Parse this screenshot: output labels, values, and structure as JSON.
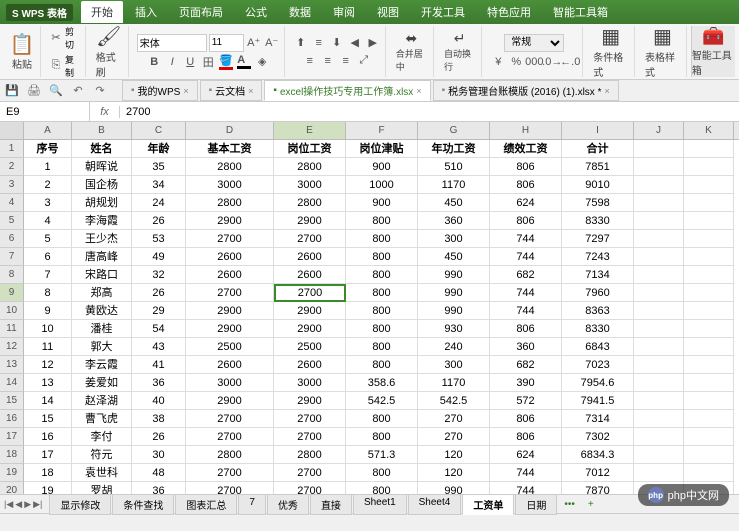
{
  "app": {
    "name": "WPS 表格"
  },
  "menus": [
    "开始",
    "插入",
    "页面布局",
    "公式",
    "数据",
    "审阅",
    "视图",
    "开发工具",
    "特色应用",
    "智能工具箱"
  ],
  "ribbon": {
    "paste": "粘贴",
    "cut": "剪切",
    "copy": "复制",
    "format_painter": "格式刷",
    "font_name": "宋体",
    "font_size": "11",
    "merge": "合并居中",
    "wrap": "自动换行",
    "normal": "常规",
    "cond_fmt": "条件格式",
    "table_style": "表格样式",
    "smart": "智能工具箱"
  },
  "doctabs": [
    {
      "label": "我的WPS",
      "active": false
    },
    {
      "label": "云文档",
      "active": false
    },
    {
      "label": "excel操作技巧专用工作簿.xlsx",
      "active": true
    },
    {
      "label": "税务管理台账模版 (2016) (1).xlsx *",
      "active": false
    }
  ],
  "formula": {
    "cell": "E9",
    "fx": "fx",
    "value": "2700"
  },
  "columns": [
    "A",
    "B",
    "C",
    "D",
    "E",
    "F",
    "G",
    "H",
    "I",
    "J",
    "K"
  ],
  "headers": [
    "序号",
    "姓名",
    "年龄",
    "基本工资",
    "岗位工资",
    "岗位津贴",
    "年功工资",
    "绩效工资",
    "合计"
  ],
  "rows": [
    [
      1,
      "朝晖说",
      35,
      2800,
      2800,
      900,
      510,
      806,
      7851
    ],
    [
      2,
      "国企杨",
      34,
      3000,
      3000,
      1000,
      1170,
      806,
      9010
    ],
    [
      3,
      "胡规划",
      24,
      2800,
      2800,
      900,
      450,
      624,
      7598
    ],
    [
      4,
      "李海霞",
      26,
      2900,
      2900,
      800,
      360,
      806,
      8330
    ],
    [
      5,
      "王少杰",
      53,
      2700,
      2700,
      800,
      300,
      744,
      7297
    ],
    [
      6,
      "唐高峰",
      49,
      2600,
      2600,
      800,
      450,
      744,
      7243
    ],
    [
      7,
      "宋路口",
      32,
      2600,
      2600,
      800,
      990,
      682,
      7134
    ],
    [
      8,
      "郑高",
      26,
      2700,
      2700,
      800,
      990,
      744,
      7960
    ],
    [
      9,
      "黄欧达",
      29,
      2900,
      2900,
      800,
      990,
      744,
      8363
    ],
    [
      10,
      "潘桂",
      54,
      2900,
      2900,
      800,
      930,
      806,
      8330
    ],
    [
      11,
      "郭大",
      43,
      2500,
      2500,
      800,
      240,
      360,
      6843
    ],
    [
      12,
      "李云霞",
      41,
      2600,
      2600,
      800,
      300,
      682,
      7023
    ],
    [
      13,
      "姜爱如",
      36,
      3000,
      3000,
      "358.6",
      1170,
      390,
      "7954.6"
    ],
    [
      14,
      "赵泽湖",
      40,
      2900,
      2900,
      "542.5",
      "542.5",
      572,
      "7941.5"
    ],
    [
      15,
      "曹飞虎",
      38,
      2700,
      2700,
      800,
      270,
      806,
      7314
    ],
    [
      16,
      "李付",
      26,
      2700,
      2700,
      800,
      270,
      806,
      7302
    ],
    [
      17,
      "符元",
      30,
      2800,
      2800,
      "571.3",
      120,
      624,
      "6834.3"
    ],
    [
      18,
      "袁世科",
      48,
      2700,
      2700,
      800,
      120,
      744,
      7012
    ],
    [
      19,
      "罗胡",
      36,
      2700,
      2700,
      800,
      990,
      744,
      7870
    ]
  ],
  "selected": {
    "row": 9,
    "col": "E"
  },
  "sheets": [
    "显示修改",
    "条件查找",
    "图表汇总",
    "7",
    "优秀",
    "直接",
    "Sheet1",
    "Sheet4",
    "工资单",
    "日期"
  ],
  "activeSheet": "工资单",
  "watermark": "php中文网"
}
